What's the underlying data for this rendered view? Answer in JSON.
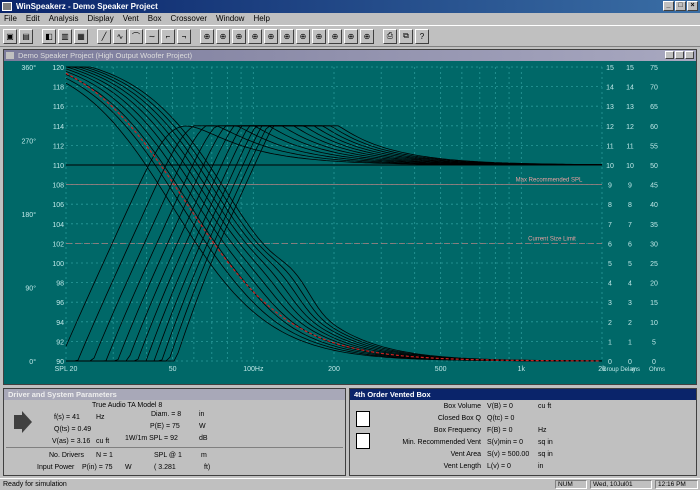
{
  "app": {
    "title": "WinSpeakerz - Demo Speaker Project"
  },
  "menu": [
    "File",
    "Edit",
    "Analysis",
    "Display",
    "Vent",
    "Box",
    "Crossover",
    "Window",
    "Help"
  ],
  "graph": {
    "title": "Demo Speaker Project (High Output Woofer Project)",
    "left_axis_ticks": [
      "120",
      "118",
      "116",
      "114",
      "112",
      "110",
      "108",
      "106",
      "104",
      "102",
      "100",
      "98",
      "96",
      "94",
      "92",
      "90"
    ],
    "phase_ticks": [
      "360°",
      "270°",
      "180°",
      "90°",
      "0°"
    ],
    "x_ticks": [
      "SPL 20",
      "50",
      "100Hz",
      "200",
      "500",
      "1k",
      "2k"
    ],
    "right1_ticks": [
      "15",
      "14",
      "13",
      "12",
      "11",
      "10",
      "9",
      "8",
      "7",
      "6",
      "5",
      "4",
      "3",
      "2",
      "1",
      "0"
    ],
    "right2_ticks": [
      "15",
      "14",
      "13",
      "12",
      "11",
      "10",
      "9",
      "8",
      "7",
      "6",
      "5",
      "4",
      "3",
      "2",
      "1",
      "0"
    ],
    "right3_ticks": [
      "75",
      "70",
      "65",
      "60",
      "55",
      "50",
      "45",
      "40",
      "35",
      "30",
      "25",
      "20",
      "15",
      "10",
      "5",
      "0"
    ],
    "bottom_right_labels": [
      "Group Delay",
      "ms",
      "Ohms"
    ],
    "annotations": {
      "max": "Max Recommended SPL",
      "current": "Current Size Limit"
    }
  },
  "driver_panel": {
    "header": "Driver and System Parameters",
    "model": "True Audio TA Model 8",
    "fs_label": "f(s) = 41",
    "fs_unit": "Hz",
    "diam_label": "Diam. = 8",
    "diam_unit": "in",
    "qts_label": "Q(ts) = 0.49",
    "pe_label": "P(E) = 75",
    "pe_unit": "W",
    "vas_label": "V(as) = 3.16",
    "vas_unit": "cu ft",
    "spl_label": "1W/1m SPL = 92",
    "spl_unit": "dB",
    "drivers_label": "No. Drivers",
    "drivers_value": "N = 1",
    "splat_label": "SPL @ 1",
    "splat_unit": "m",
    "input_label": "Input Power",
    "input_value": "P(in) = 75",
    "input_unit": "W",
    "ft_value": "( 3.281",
    "ft_unit": "ft)"
  },
  "box_panel": {
    "header": "4th Order Vented Box",
    "rows": [
      {
        "label": "Box Volume",
        "value": "V(B) = 0",
        "unit": "cu ft"
      },
      {
        "label": "Closed Box Q",
        "value": "Q(tc) = 0",
        "unit": ""
      },
      {
        "label": "Box Frequency",
        "value": "F(B) = 0",
        "unit": "Hz"
      },
      {
        "label": "Min. Recommended Vent",
        "value": "S(v)min = 0",
        "unit": "sq in"
      },
      {
        "label": "Vent Area",
        "value": "S(v) = 500.00",
        "unit": "sq in"
      },
      {
        "label": "Vent Length",
        "value": "L(v) = 0",
        "unit": "in"
      }
    ]
  },
  "status": {
    "text": "Ready for simulation",
    "num": "NUM",
    "date": "Wed, 10Jul01",
    "time": "12:16 PM"
  },
  "colors": {
    "plot_bg": "#006868",
    "grid": "#2a9a9a",
    "curves": "#000000",
    "red_curve": "#cc2020"
  }
}
